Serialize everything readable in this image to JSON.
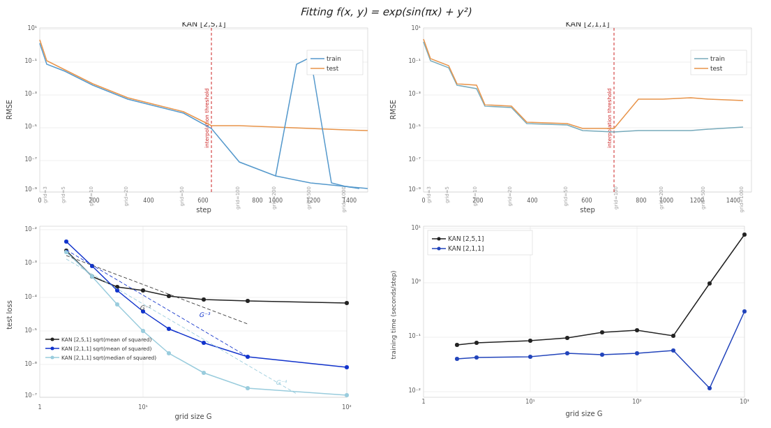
{
  "page": {
    "title": "Fitting f(x, y) = exp(sin(πx) + y²)",
    "title_display": "Fitting f(x, y) = exp(sin(πx) + y²)"
  },
  "top_left": {
    "title": "KAN [2,5,1]",
    "xlabel": "step",
    "ylabel": "RMSE",
    "legend": [
      "train",
      "test"
    ],
    "annotation": "interpolation threshold"
  },
  "top_right": {
    "title": "KAN [2,1,1]",
    "xlabel": "step",
    "ylabel": "RMSE",
    "legend": [
      "train",
      "test"
    ],
    "annotation": "interpolation threshold"
  },
  "bottom_left": {
    "xlabel": "grid size G",
    "ylabel": "test loss",
    "legend": [
      "KAN [2,5,1] sqrt(mean of squared)",
      "KAN [2,1,1] sqrt(mean of squared)",
      "KAN [2,1,1] sqrt(median of squared)"
    ],
    "annotations": [
      "G⁻²",
      "G⁻³",
      "G⁻⁴"
    ]
  },
  "bottom_right": {
    "xlabel": "grid size G",
    "ylabel": "training time (seconds/step)",
    "legend": [
      "KAN [2,5,1]",
      "KAN [2,1,1]"
    ]
  }
}
